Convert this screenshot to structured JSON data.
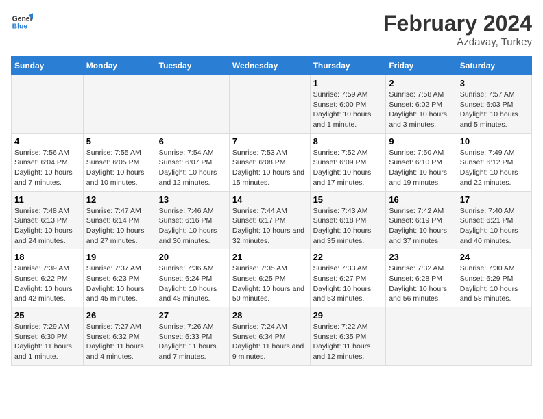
{
  "logo": {
    "line1": "General",
    "line2": "Blue"
  },
  "title": "February 2024",
  "subtitle": "Azdavay, Turkey",
  "days_of_week": [
    "Sunday",
    "Monday",
    "Tuesday",
    "Wednesday",
    "Thursday",
    "Friday",
    "Saturday"
  ],
  "weeks": [
    [
      {
        "day": "",
        "info": ""
      },
      {
        "day": "",
        "info": ""
      },
      {
        "day": "",
        "info": ""
      },
      {
        "day": "",
        "info": ""
      },
      {
        "day": "1",
        "info": "Sunrise: 7:59 AM\nSunset: 6:00 PM\nDaylight: 10 hours and 1 minute."
      },
      {
        "day": "2",
        "info": "Sunrise: 7:58 AM\nSunset: 6:02 PM\nDaylight: 10 hours and 3 minutes."
      },
      {
        "day": "3",
        "info": "Sunrise: 7:57 AM\nSunset: 6:03 PM\nDaylight: 10 hours and 5 minutes."
      }
    ],
    [
      {
        "day": "4",
        "info": "Sunrise: 7:56 AM\nSunset: 6:04 PM\nDaylight: 10 hours and 7 minutes."
      },
      {
        "day": "5",
        "info": "Sunrise: 7:55 AM\nSunset: 6:05 PM\nDaylight: 10 hours and 10 minutes."
      },
      {
        "day": "6",
        "info": "Sunrise: 7:54 AM\nSunset: 6:07 PM\nDaylight: 10 hours and 12 minutes."
      },
      {
        "day": "7",
        "info": "Sunrise: 7:53 AM\nSunset: 6:08 PM\nDaylight: 10 hours and 15 minutes."
      },
      {
        "day": "8",
        "info": "Sunrise: 7:52 AM\nSunset: 6:09 PM\nDaylight: 10 hours and 17 minutes."
      },
      {
        "day": "9",
        "info": "Sunrise: 7:50 AM\nSunset: 6:10 PM\nDaylight: 10 hours and 19 minutes."
      },
      {
        "day": "10",
        "info": "Sunrise: 7:49 AM\nSunset: 6:12 PM\nDaylight: 10 hours and 22 minutes."
      }
    ],
    [
      {
        "day": "11",
        "info": "Sunrise: 7:48 AM\nSunset: 6:13 PM\nDaylight: 10 hours and 24 minutes."
      },
      {
        "day": "12",
        "info": "Sunrise: 7:47 AM\nSunset: 6:14 PM\nDaylight: 10 hours and 27 minutes."
      },
      {
        "day": "13",
        "info": "Sunrise: 7:46 AM\nSunset: 6:16 PM\nDaylight: 10 hours and 30 minutes."
      },
      {
        "day": "14",
        "info": "Sunrise: 7:44 AM\nSunset: 6:17 PM\nDaylight: 10 hours and 32 minutes."
      },
      {
        "day": "15",
        "info": "Sunrise: 7:43 AM\nSunset: 6:18 PM\nDaylight: 10 hours and 35 minutes."
      },
      {
        "day": "16",
        "info": "Sunrise: 7:42 AM\nSunset: 6:19 PM\nDaylight: 10 hours and 37 minutes."
      },
      {
        "day": "17",
        "info": "Sunrise: 7:40 AM\nSunset: 6:21 PM\nDaylight: 10 hours and 40 minutes."
      }
    ],
    [
      {
        "day": "18",
        "info": "Sunrise: 7:39 AM\nSunset: 6:22 PM\nDaylight: 10 hours and 42 minutes."
      },
      {
        "day": "19",
        "info": "Sunrise: 7:37 AM\nSunset: 6:23 PM\nDaylight: 10 hours and 45 minutes."
      },
      {
        "day": "20",
        "info": "Sunrise: 7:36 AM\nSunset: 6:24 PM\nDaylight: 10 hours and 48 minutes."
      },
      {
        "day": "21",
        "info": "Sunrise: 7:35 AM\nSunset: 6:25 PM\nDaylight: 10 hours and 50 minutes."
      },
      {
        "day": "22",
        "info": "Sunrise: 7:33 AM\nSunset: 6:27 PM\nDaylight: 10 hours and 53 minutes."
      },
      {
        "day": "23",
        "info": "Sunrise: 7:32 AM\nSunset: 6:28 PM\nDaylight: 10 hours and 56 minutes."
      },
      {
        "day": "24",
        "info": "Sunrise: 7:30 AM\nSunset: 6:29 PM\nDaylight: 10 hours and 58 minutes."
      }
    ],
    [
      {
        "day": "25",
        "info": "Sunrise: 7:29 AM\nSunset: 6:30 PM\nDaylight: 11 hours and 1 minute."
      },
      {
        "day": "26",
        "info": "Sunrise: 7:27 AM\nSunset: 6:32 PM\nDaylight: 11 hours and 4 minutes."
      },
      {
        "day": "27",
        "info": "Sunrise: 7:26 AM\nSunset: 6:33 PM\nDaylight: 11 hours and 7 minutes."
      },
      {
        "day": "28",
        "info": "Sunrise: 7:24 AM\nSunset: 6:34 PM\nDaylight: 11 hours and 9 minutes."
      },
      {
        "day": "29",
        "info": "Sunrise: 7:22 AM\nSunset: 6:35 PM\nDaylight: 11 hours and 12 minutes."
      },
      {
        "day": "",
        "info": ""
      },
      {
        "day": "",
        "info": ""
      }
    ]
  ]
}
